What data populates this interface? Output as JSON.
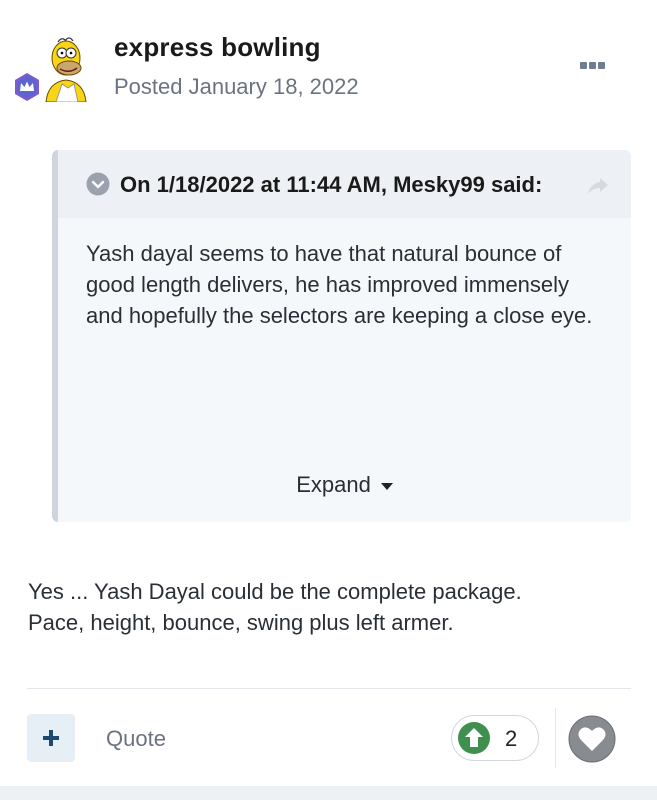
{
  "post": {
    "author": "express bowling",
    "date": "Posted January 18, 2022",
    "avatar_icon": "homer-simpson-avatar",
    "badge_icon": "crown-rank-badge-icon",
    "menu_icon": "ellipsis-icon"
  },
  "quote": {
    "citation": "On 1/18/2022 at 11:44 AM, Mesky99 said:",
    "toggle_icon": "chevron-down-circle-icon",
    "jump_icon": "share-arrow-icon",
    "body": "Yash dayal seems to have that natural bounce of good length delivers, he has improved immensely and hopefully the selectors are keeping a close eye.",
    "expand_label": "Expand"
  },
  "body": {
    "lines": [
      "Yes ... Yash Dayal could be the complete package.",
      "Pace, height, bounce, swing plus left armer."
    ]
  },
  "actions": {
    "multiquote_icon": "plus-icon",
    "quote_label": "Quote",
    "reaction_icon": "upvote-arrow-icon",
    "reaction_count": "2",
    "like_icon": "heart-icon"
  },
  "colors": {
    "upvote_green": "#3f8f4f",
    "link_muted": "#6b7380",
    "quote_bg": "#f5f8fb",
    "quote_head_bg": "#edf0f4",
    "multiquote_bg": "#e6eef6"
  }
}
